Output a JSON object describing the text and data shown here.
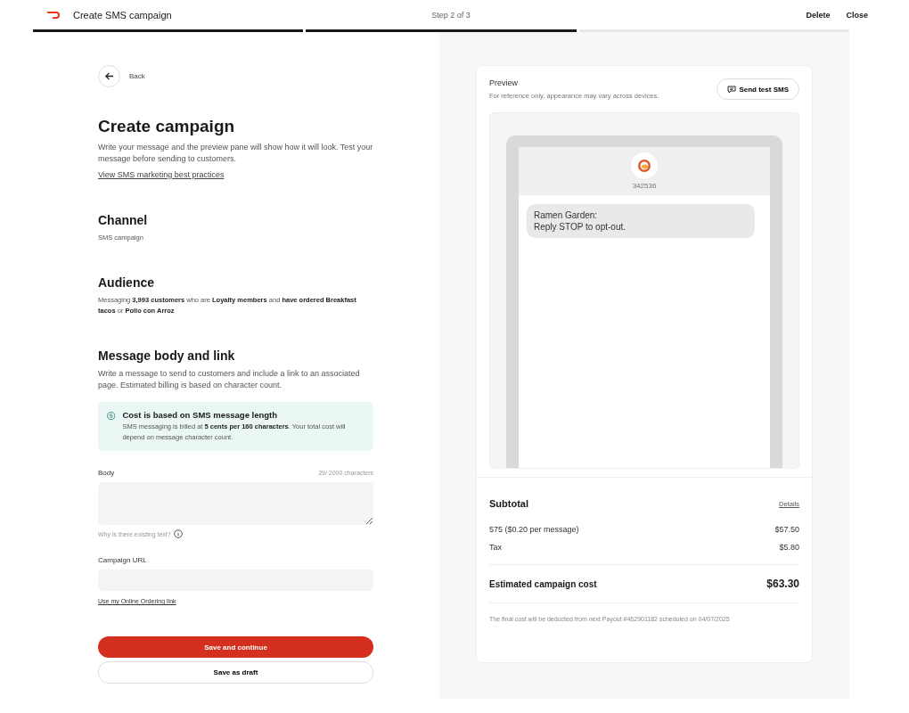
{
  "header": {
    "title": "Create SMS campaign",
    "step": "Step 2 of 3",
    "actions": [
      "Delete",
      "Close"
    ]
  },
  "steps": [
    {
      "complete": true
    },
    {
      "complete": true
    },
    {
      "complete": false
    }
  ],
  "back": "Back",
  "page": {
    "title": "Create campaign",
    "intro": "Write your message and the preview pane will show how it will look. Test your message before sending to customers.",
    "link": "View SMS marketing best practices"
  },
  "channel": {
    "heading": "Channel",
    "value": "SMS campaign"
  },
  "audience": {
    "heading": "Audience",
    "text": "Messaging **3,993 customers** who are **Loyalty members** and **have ordered Breakfast tacos** or **Pollo con Arroz**"
  },
  "message": {
    "heading": "Message body and link",
    "text": "Write a message to send to customers and include a link to an associated page. Estimated billing is based on character count."
  },
  "notice": {
    "title": "Cost is based on SMS message length",
    "text": "SMS messaging is billed at **5 cents per 160 characters**. Your total cost will depend on message character count."
  },
  "body": {
    "label": "Body",
    "count": "29/ 2000 characters",
    "help": "Why is there existing text?"
  },
  "url": {
    "label": "Campaign URL",
    "link": "Use my Online Ordering link"
  },
  "buttons": {
    "primary": "Save and continue",
    "secondary": "Save as draft"
  },
  "preview": {
    "title": "Preview",
    "subtitle": "For reference only, appearance may vary across devices.",
    "button": "Send test SMS",
    "sender": "342536",
    "bubble": [
      "Ramen Garden:",
      "Reply STOP to opt-out."
    ]
  },
  "summary": {
    "heading": "Subtotal",
    "details": "Details",
    "lines": [
      {
        "label": "575 ($0.20 per message)",
        "amount": "$57.50"
      },
      {
        "label": "Tax",
        "amount": "$5.80"
      }
    ],
    "total_label": "Estimated campaign cost",
    "total": "$63.30",
    "footnote": "The final cost will be deducted from next Payout #462901182 scheduled on 04/07/2025"
  }
}
